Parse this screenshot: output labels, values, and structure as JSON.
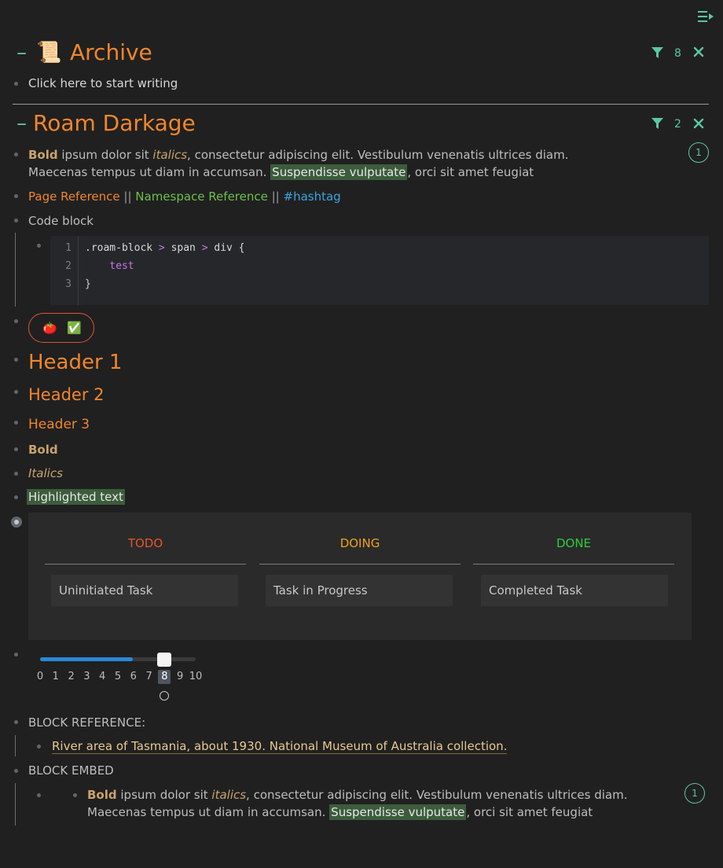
{
  "topbar": {
    "menu_icon": "sidebar-collapse-icon"
  },
  "archive": {
    "title": "Archive",
    "emoji": "📜",
    "filter_count": "8",
    "placeholder": "Click here to start writing"
  },
  "roam": {
    "title": "Roam Darkage",
    "filter_count": "2",
    "para1": {
      "bold": "Bold",
      "t1": " ipsum dolor sit ",
      "italic": "italics",
      "t2": ", consectetur adipiscing elit. Vestibulum venenatis ultrices diam.",
      "line2_a": "Maecenas tempus ut diam in accumsan. ",
      "highlight": "Suspendisse vulputate",
      "line2_b": ", orci sit amet feugiat",
      "ref_count": "1"
    },
    "refs": {
      "page_ref": "Page Reference",
      "sep1": " || ",
      "namespace_ref": "Namespace Reference",
      "sep2": " || ",
      "hashtag": "#hashtag"
    },
    "code_label": "Code block",
    "code": {
      "lines": [
        "1",
        "2",
        "3"
      ],
      "l1_sel": ".roam-block ",
      "l1_gt1": ">",
      "l1_span": " span ",
      "l1_gt2": ">",
      "l1_div": " div {",
      "l2": "    test",
      "l3": "}"
    },
    "pill": {
      "tomato": "🍅",
      "check": "✅"
    },
    "h1": "Header 1",
    "h2": "Header 2",
    "h3": "Header 3",
    "bold": "Bold",
    "italics": "Italics",
    "highlighted": "Highlighted text",
    "kanban": {
      "todo": "TODO",
      "doing": "DOING",
      "done": "DONE",
      "todo_color": "#e0562c",
      "doing_color": "#f0a020",
      "done_color": "#2ecc40",
      "card_todo": "Uninitiated Task",
      "card_doing": "Task in Progress",
      "card_done": "Completed Task"
    },
    "slider": {
      "value": 8,
      "min": 0,
      "max": 10,
      "ticks": [
        "0",
        "1",
        "2",
        "3",
        "4",
        "5",
        "6",
        "7",
        "8",
        "9",
        "10"
      ]
    },
    "block_ref_label": "BLOCK REFERENCE:",
    "block_ref_text": "River area of Tasmania, about 1930. National Museum of Australia collection.",
    "block_embed_label": "BLOCK EMBED",
    "embed_ref_count": "1"
  }
}
